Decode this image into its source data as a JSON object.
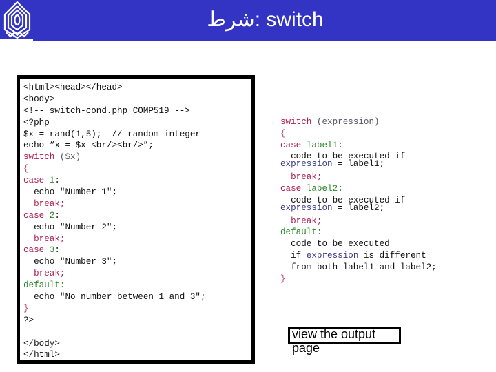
{
  "header": {
    "title": "switch :شرط",
    "background_color": "#3333c4",
    "logo_icon": "university-emblem-icon"
  },
  "colors": {
    "keyword": "#b0204e",
    "literal": "#2a8a2a",
    "expression": "#3a3a8a",
    "text": "#111111"
  },
  "example_code": {
    "lines": [
      [
        {
          "t": "<html><head></head>",
          "c": "plain"
        }
      ],
      [
        {
          "t": "<body>",
          "c": "plain"
        }
      ],
      [
        {
          "t": "<!-- switch-cond.php COMP519 -->",
          "c": "plain"
        }
      ],
      [
        {
          "t": "<?php",
          "c": "plain"
        }
      ],
      [
        {
          "t": "$x = rand(1,5);  // random integer",
          "c": "plain"
        }
      ],
      [
        {
          "t": "echo “x = $x <br/><br/>”;",
          "c": "plain"
        }
      ],
      [
        {
          "t": "switch",
          "c": "kw"
        },
        {
          "t": " ($x)",
          "c": "paren"
        }
      ],
      [
        {
          "t": "{",
          "c": "brace"
        }
      ],
      [
        {
          "t": "case",
          "c": "kw"
        },
        {
          "t": " ",
          "c": "plain"
        },
        {
          "t": "1",
          "c": "num"
        },
        {
          "t": ":",
          "c": "plain"
        }
      ],
      [
        {
          "t": "  echo \"Number 1\";",
          "c": "plain"
        }
      ],
      [
        {
          "t": "  break;",
          "c": "kw"
        }
      ],
      [
        {
          "t": "case",
          "c": "kw"
        },
        {
          "t": " ",
          "c": "plain"
        },
        {
          "t": "2",
          "c": "num"
        },
        {
          "t": ":",
          "c": "plain"
        }
      ],
      [
        {
          "t": "  echo \"Number 2\";",
          "c": "plain"
        }
      ],
      [
        {
          "t": "  break;",
          "c": "kw"
        }
      ],
      [
        {
          "t": "case",
          "c": "kw"
        },
        {
          "t": " ",
          "c": "plain"
        },
        {
          "t": "3",
          "c": "num"
        },
        {
          "t": ":",
          "c": "plain"
        }
      ],
      [
        {
          "t": "  echo \"Number 3\";",
          "c": "plain"
        }
      ],
      [
        {
          "t": "  break;",
          "c": "kw"
        }
      ],
      [
        {
          "t": "default:",
          "c": "num"
        }
      ],
      [
        {
          "t": "  echo \"No number between 1 and 3\";",
          "c": "plain"
        }
      ],
      [
        {
          "t": "}",
          "c": "brace"
        }
      ],
      [
        {
          "t": "?>",
          "c": "plain"
        }
      ],
      [
        {
          "t": "",
          "c": "plain"
        }
      ],
      [
        {
          "t": "</body>",
          "c": "plain"
        }
      ],
      [
        {
          "t": "</html>",
          "c": "plain"
        }
      ]
    ]
  },
  "syntax_code": {
    "lines": [
      {
        "parts": [
          {
            "t": "switch",
            "c": "kw"
          },
          {
            "t": " (expression)",
            "c": "paren"
          }
        ]
      },
      {
        "parts": [
          {
            "t": "{",
            "c": "brace"
          }
        ]
      },
      {
        "parts": [
          {
            "t": "case",
            "c": "kw"
          },
          {
            "t": " ",
            "c": "plain"
          },
          {
            "t": "label1",
            "c": "num"
          },
          {
            "t": ":",
            "c": "plain"
          }
        ]
      },
      {
        "parts": [
          {
            "t": "  code to be executed if",
            "c": "plain"
          }
        ]
      },
      {
        "parts": [
          {
            "t": "expression",
            "c": "expr"
          },
          {
            "t": " = label1;",
            "c": "plain"
          }
        ],
        "tight": true
      },
      {
        "parts": [
          {
            "t": "  break;",
            "c": "kw"
          }
        ]
      },
      {
        "parts": [
          {
            "t": "case",
            "c": "kw"
          },
          {
            "t": " ",
            "c": "plain"
          },
          {
            "t": "label2",
            "c": "num"
          },
          {
            "t": ":",
            "c": "plain"
          }
        ]
      },
      {
        "parts": [
          {
            "t": "  code to be executed if",
            "c": "plain"
          }
        ]
      },
      {
        "parts": [
          {
            "t": "expression",
            "c": "expr"
          },
          {
            "t": " = label2;",
            "c": "plain"
          }
        ],
        "tight": true
      },
      {
        "parts": [
          {
            "t": "  break;",
            "c": "kw"
          }
        ]
      },
      {
        "parts": [
          {
            "t": "default:",
            "c": "num"
          }
        ]
      },
      {
        "parts": [
          {
            "t": "  code to be executed",
            "c": "plain"
          }
        ]
      },
      {
        "parts": [
          {
            "t": "  if ",
            "c": "plain"
          },
          {
            "t": "expression",
            "c": "expr"
          },
          {
            "t": " is different",
            "c": "plain"
          }
        ]
      },
      {
        "parts": [
          {
            "t": "  from both label1 and label2;",
            "c": "plain"
          }
        ]
      },
      {
        "parts": [
          {
            "t": "}",
            "c": "brace"
          }
        ]
      }
    ]
  },
  "output_link": {
    "label": "view the output page"
  }
}
